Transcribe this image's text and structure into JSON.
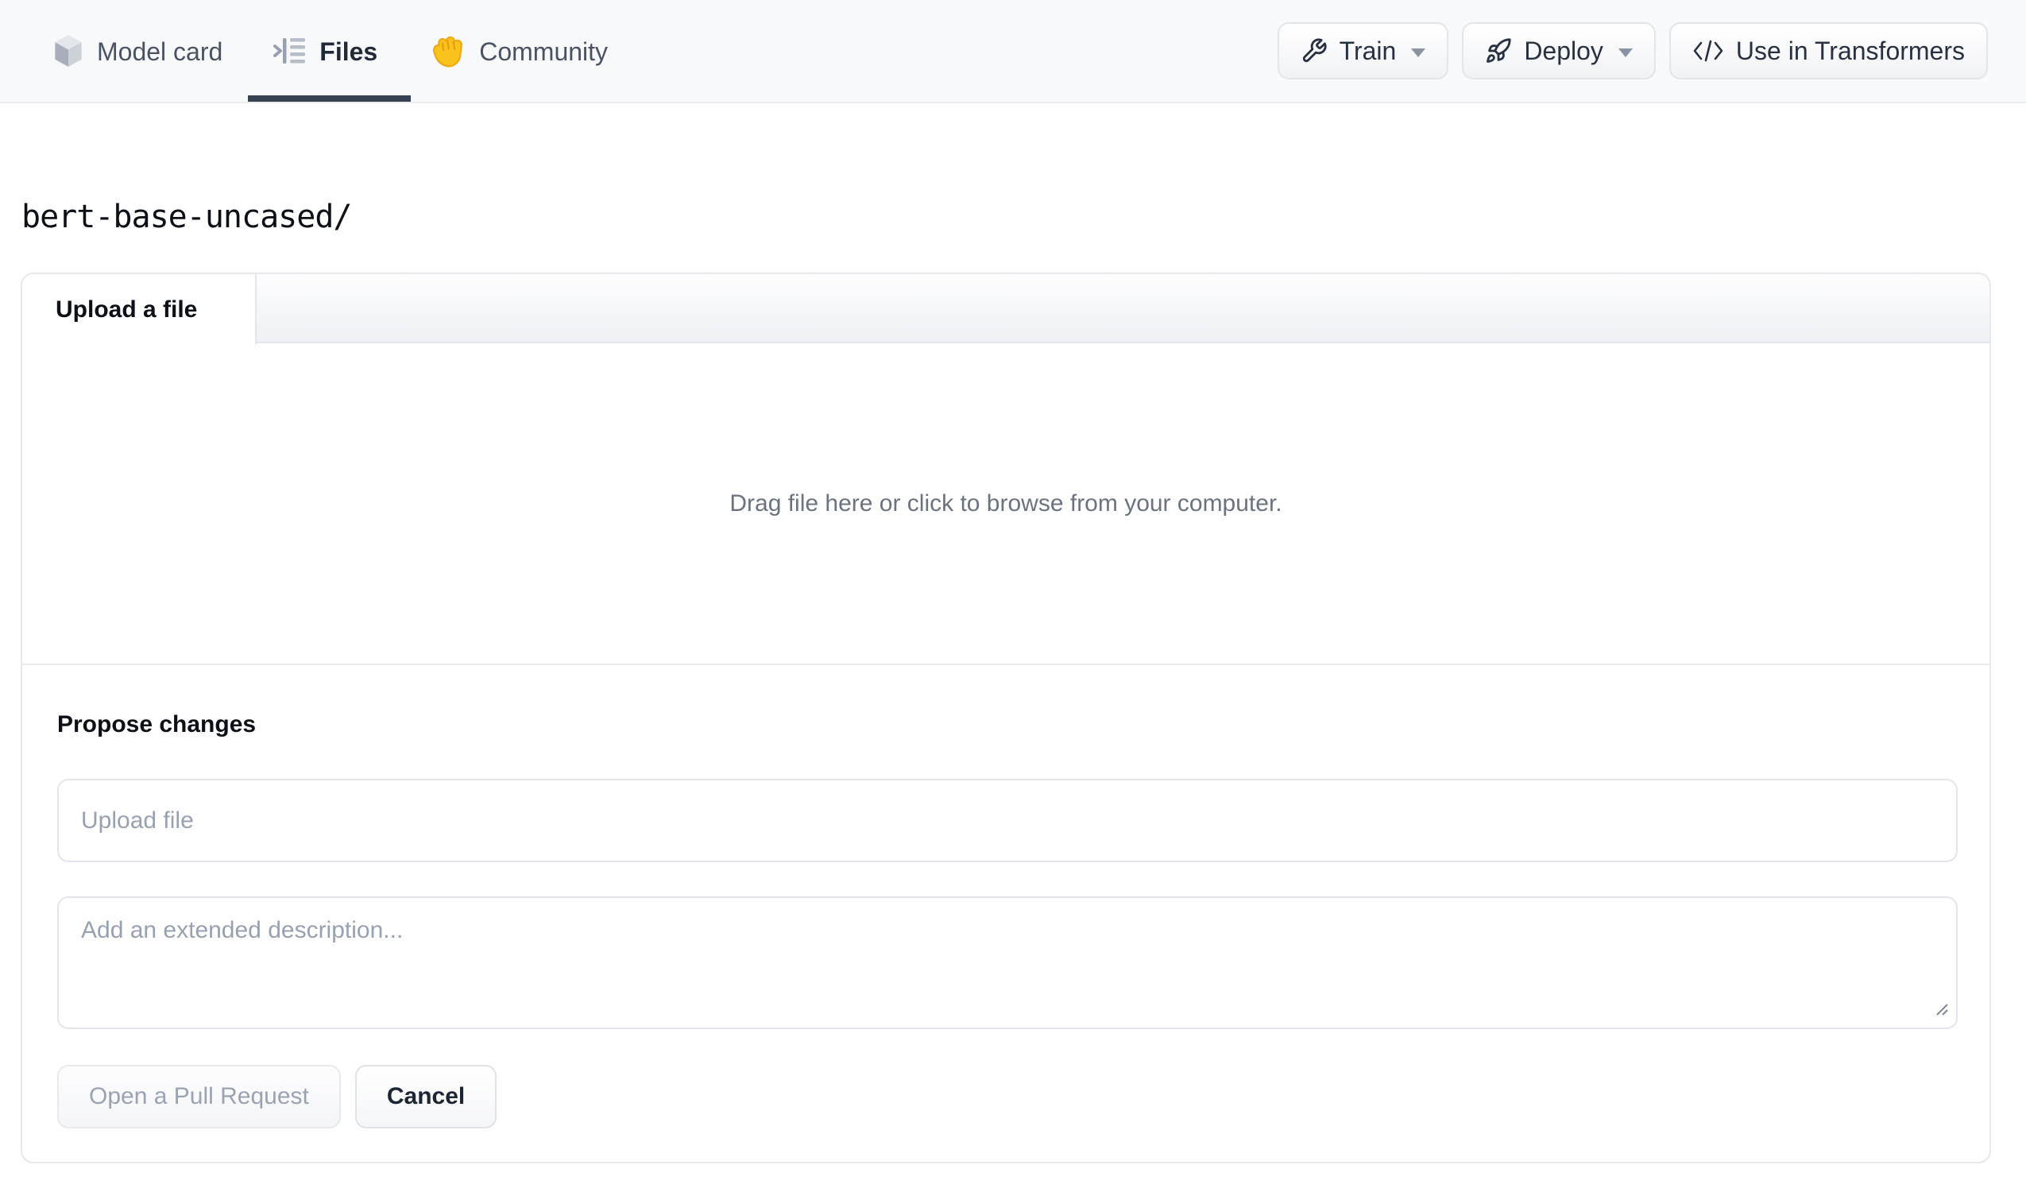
{
  "header": {
    "tabs": [
      {
        "label": "Model card",
        "icon": "cube-icon",
        "active": false
      },
      {
        "label": "Files",
        "icon": "files-list-icon",
        "active": true
      },
      {
        "label": "Community",
        "icon": "waving-hand-icon",
        "active": false
      }
    ],
    "actions": [
      {
        "label": "Train",
        "icon": "wrench-icon",
        "has_caret": true
      },
      {
        "label": "Deploy",
        "icon": "rocket-icon",
        "has_caret": true
      },
      {
        "label": "Use in Transformers",
        "icon": "code-icon",
        "has_caret": false
      }
    ]
  },
  "breadcrumb": {
    "path": "bert-base-uncased/"
  },
  "upload_panel": {
    "tab_label": "Upload a file",
    "dropzone_text": "Drag file here or click to browse from your computer.",
    "propose": {
      "heading": "Propose changes",
      "filename_placeholder": "Upload file",
      "description_placeholder": "Add an extended description...",
      "submit_label": "Open a Pull Request",
      "cancel_label": "Cancel"
    }
  },
  "colors": {
    "header_bg": "#f8f9fb",
    "active_tab_underline": "#364152",
    "border": "#e5e7eb",
    "dark_text": "#1f2937",
    "muted_text": "#6b7380",
    "placeholder_text": "#98a1b1",
    "hand_emoji_fill": "#fac21c",
    "hand_emoji_stroke": "#efa80f"
  }
}
